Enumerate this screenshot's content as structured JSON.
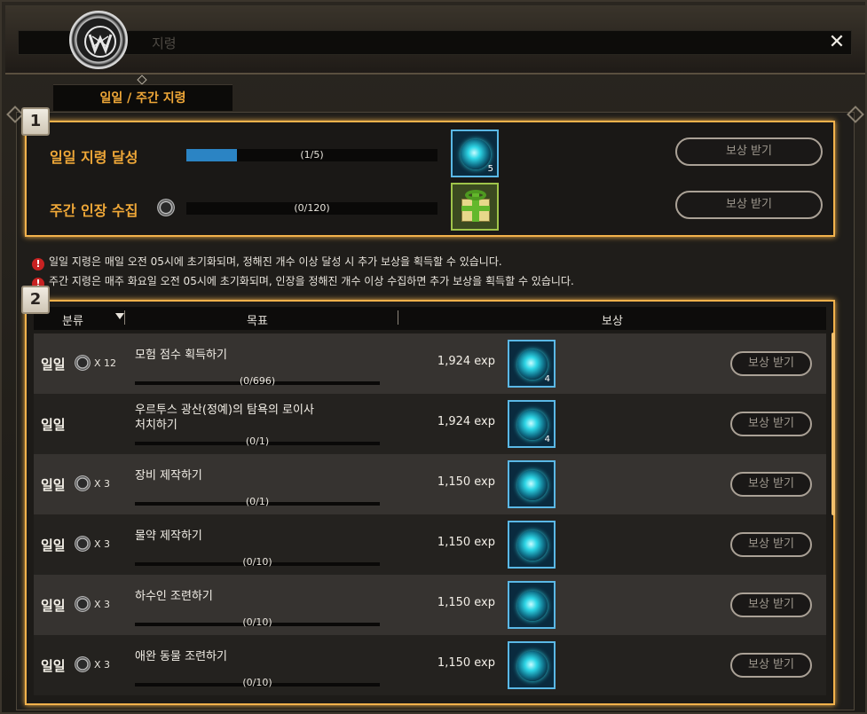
{
  "window": {
    "title": "지령",
    "close_label": "✕"
  },
  "tab": {
    "label": "일일 / 주간 지령"
  },
  "section_badges": [
    "1",
    "2"
  ],
  "summary": [
    {
      "label": "일일 지령 달성",
      "progress_text": "(1/5)",
      "progress": 0.2,
      "reward_count": "5",
      "button": "보상 받기",
      "has_seal": false
    },
    {
      "label": "주간 인장 수집",
      "progress_text": "(0/120)",
      "progress": 0.0,
      "reward_count": "",
      "button": "보상 받기",
      "has_seal": true
    }
  ],
  "notices": [
    "일일 지령은 매일 오전 05시에 초기화되며, 정해진 개수 이상 달성 시 추가 보상을 획득할 수 있습니다.",
    "주간 지령은 매주 화요일 오전 05시에 초기화되며, 인장을 정해진 개수 이상 수집하면 추가 보상을 획득할 수 있습니다."
  ],
  "table": {
    "headers": {
      "category": "분류",
      "goal": "목표",
      "reward": "보상"
    },
    "rows": [
      {
        "category": "일일",
        "multiplier": "X 12",
        "goal": "모험 점수 획득하기",
        "progress_text": "(0/696)",
        "exp": "1,924 exp",
        "icon_count": "4",
        "button": "보상 받기"
      },
      {
        "category": "일일",
        "multiplier": "",
        "goal": "우르투스 광산(정예)의 탐욕의 로이사\n처치하기",
        "progress_text": "(0/1)",
        "exp": "1,924 exp",
        "icon_count": "4",
        "button": "보상 받기"
      },
      {
        "category": "일일",
        "multiplier": "X 3",
        "goal": "장비 제작하기",
        "progress_text": "(0/1)",
        "exp": "1,150 exp",
        "icon_count": "",
        "button": "보상 받기"
      },
      {
        "category": "일일",
        "multiplier": "X 3",
        "goal": "물약 제작하기",
        "progress_text": "(0/10)",
        "exp": "1,150 exp",
        "icon_count": "",
        "button": "보상 받기"
      },
      {
        "category": "일일",
        "multiplier": "X 3",
        "goal": "하수인 조련하기",
        "progress_text": "(0/10)",
        "exp": "1,150 exp",
        "icon_count": "",
        "button": "보상 받기"
      },
      {
        "category": "일일",
        "multiplier": "X 3",
        "goal": "애완 동물 조련하기",
        "progress_text": "(0/10)",
        "exp": "1,150 exp",
        "icon_count": "",
        "button": "보상 받기"
      }
    ]
  },
  "colors": {
    "accent": "#f0a838",
    "highlight_border": "#f2b24c",
    "progress_fill": "#2b84c4",
    "orb": "#2ed6e6"
  },
  "icons": {
    "emblem": "guild-emblem-icon",
    "seal": "seal-icon",
    "reward_orb": "exp-orb-icon",
    "gift": "gift-box-icon",
    "warning": "warning-icon"
  }
}
